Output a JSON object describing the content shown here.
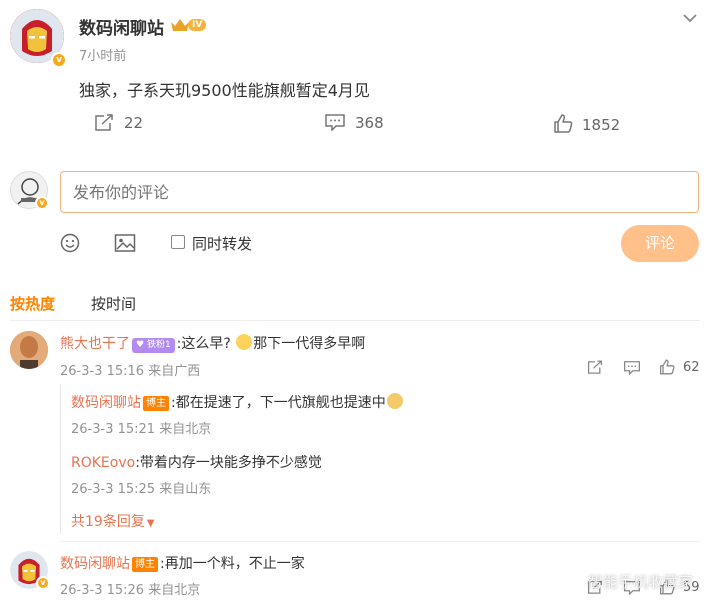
{
  "post": {
    "author": "数码闲聊站",
    "level_badge": "IV",
    "time": "7小时前",
    "text": "独家，子系天玑9500性能旗舰暂定4月见",
    "reposts": "22",
    "comments": "368",
    "likes": "1852"
  },
  "composer": {
    "placeholder": "发布你的评论",
    "repost_label": "同时转发",
    "submit_label": "评论"
  },
  "sort_tabs": {
    "hot": "按热度",
    "time": "按时间"
  },
  "comments": [
    {
      "author": "熊大也干了",
      "fan_badge": "铁粉1",
      "text_a": ":这么早?",
      "text_b": "那下一代得多早啊",
      "meta": "26-3-3 15:16 来自广西",
      "likes": "62",
      "replies": [
        {
          "author": "数码闲聊站",
          "badge": "博主",
          "text": ":都在提速了，下一代旗舰也提速中",
          "meta": "26-3-3 15:21 来自北京"
        },
        {
          "author": "ROKEovo",
          "text": ":带着内存一块能多挣不少感觉",
          "meta": "26-3-3 15:25 来自山东"
        }
      ],
      "more_replies": "共19条回复"
    },
    {
      "author": "数码闲聊站",
      "badge": "博主",
      "text": ":再加一个料，不止一家",
      "meta": "26-3-3 15:26 来自北京",
      "likes": "59"
    }
  ],
  "watermark": "智能手机收藏家",
  "colors": {
    "accent_orange": "#ff8200",
    "link_orange": "#eb7350",
    "submit_disabled": "#ffc08a",
    "input_border": "#f5b27e"
  }
}
